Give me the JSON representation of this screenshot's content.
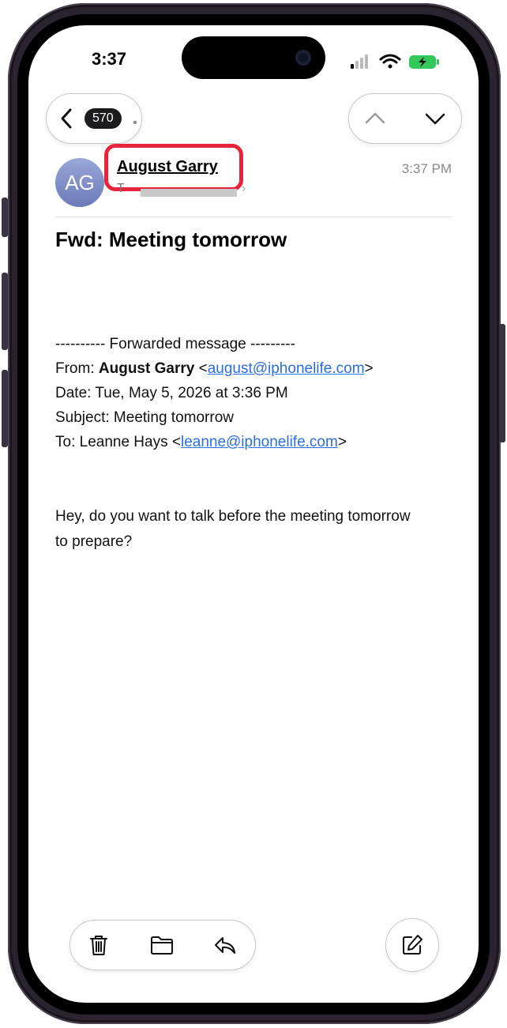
{
  "status_bar": {
    "time": "3:37"
  },
  "nav": {
    "unread_count": "570"
  },
  "email": {
    "avatar_initials": "AG",
    "sender_name": "August Garry",
    "to_prefix": "T",
    "received_time": "3:37 PM",
    "subject": "Fwd: Meeting tomorrow",
    "forward_header": "---------- Forwarded message ---------",
    "from_label": "From: ",
    "from_name": "August Garry",
    "from_open": " <",
    "from_email": "august@iphonelife.com",
    "from_close": ">",
    "date_line": "Date: Tue, May 5, 2026 at 3:36 PM",
    "subject_line": "Subject: Meeting tomorrow",
    "to_label": "To: Leanne Hays <",
    "to_email": "leanne@iphonelife.com",
    "to_close": ">",
    "message": "Hey, do you want to talk before the meeting tomorrow to prepare?"
  },
  "icons": {
    "back": "chevron-left-icon",
    "prev": "chevron-up-icon",
    "next": "chevron-down-icon",
    "trash": "trash-icon",
    "folder": "folder-icon",
    "reply": "reply-icon",
    "compose": "compose-icon"
  },
  "colors": {
    "accent": "#2a6ee0",
    "highlight": "#e8243d",
    "battery": "#34c759"
  }
}
